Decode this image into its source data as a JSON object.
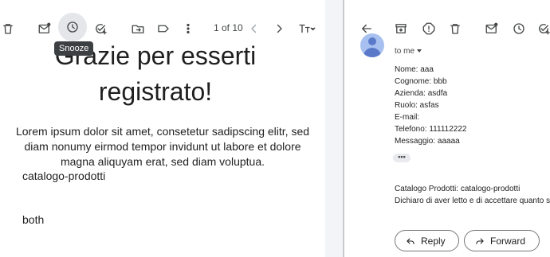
{
  "left_pane": {
    "toolbar": {
      "tooltip": "Snooze",
      "pager": "1 of 10",
      "icons": [
        "delete-icon",
        "mark-unread-icon",
        "snooze-icon",
        "add-task-icon",
        "move-to-icon",
        "label-icon",
        "more-icon",
        "chevron-left-icon",
        "chevron-right-icon",
        "input-tools-icon"
      ]
    },
    "email": {
      "title_line1": "Grazie per esserti",
      "title_line2": "registrato!",
      "lorem_line1": "Lorem ipsum dolor sit amet, consetetur sadipscing elitr, sed",
      "lorem_line2": "diam nonumy eirmod tempor invidunt ut labore et dolore",
      "lorem_line3": "magna aliquyam erat, sed diam voluptua.",
      "catalog": "catalogo-prodotti",
      "both": "both"
    }
  },
  "right_pane": {
    "toolbar": {
      "icons": [
        "back-icon",
        "archive-icon",
        "report-spam-icon",
        "delete-icon",
        "mark-unread-icon",
        "snooze-icon",
        "add-task-icon"
      ]
    },
    "message": {
      "to": "to me",
      "fields": [
        "Nome: aaa",
        "Cognome: bbb",
        "Azienda: asdfa",
        "Ruolo: asfas",
        "E-mail:",
        "Telefono: 111112222",
        "Messaggio: aaaaa"
      ],
      "ellipsis": "•••",
      "catalog_line": "Catalogo Prodotti: catalogo-prodotti",
      "consent_line": "Dichiaro di aver letto e di accettare quanto s"
    },
    "actions": {
      "reply": "Reply",
      "forward": "Forward"
    }
  }
}
